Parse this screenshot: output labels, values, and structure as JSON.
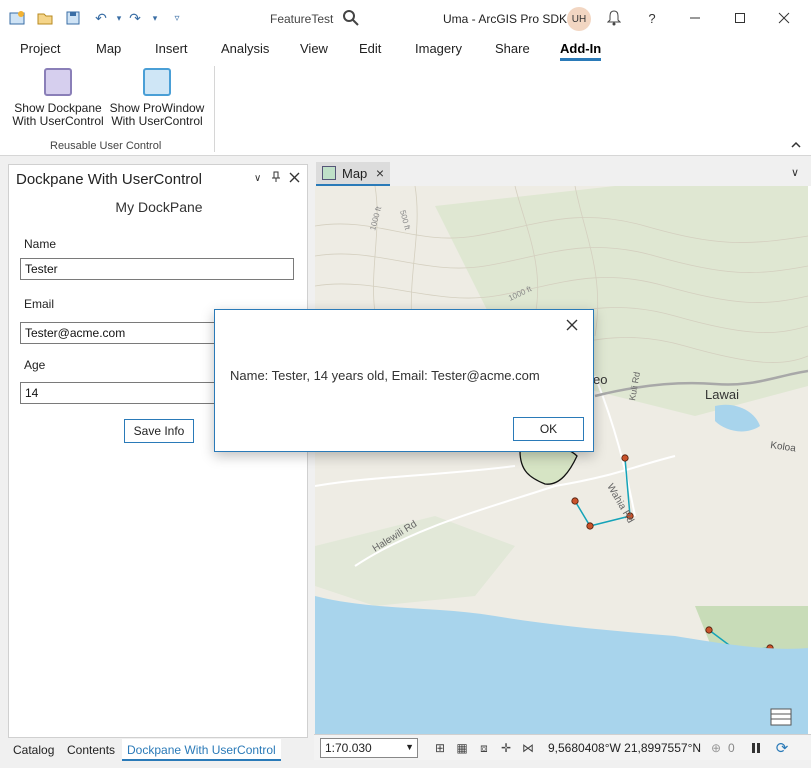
{
  "titlebar": {
    "document": "FeatureTest",
    "title": "Uma - ArcGIS Pro SDK",
    "avatar_initials": "UH",
    "help_label": "?"
  },
  "ribbon_tabs": [
    {
      "label": "Project"
    },
    {
      "label": "Map"
    },
    {
      "label": "Insert"
    },
    {
      "label": "Analysis"
    },
    {
      "label": "View"
    },
    {
      "label": "Edit"
    },
    {
      "label": "Imagery"
    },
    {
      "label": "Share"
    },
    {
      "label": "Add-In",
      "active": true
    }
  ],
  "ribbon": {
    "buttons": [
      {
        "line1": "Show Dockpane",
        "line2": "With UserControl",
        "icon": "dockpane-icon",
        "color": "#8a7fb8"
      },
      {
        "line1": "Show ProWindow",
        "line2": "With UserControl",
        "icon": "prowindow-icon",
        "color": "#4a9fd6"
      }
    ],
    "group_label": "Reusable User Control"
  },
  "dockpane": {
    "title": "Dockpane With UserControl",
    "heading": "My DockPane",
    "name_label": "Name",
    "name_value": "Tester",
    "email_label": "Email",
    "email_value": "Tester@acme.com",
    "age_label": "Age",
    "age_value": "14",
    "save_label": "Save Info"
  },
  "bottom_tabs": [
    {
      "label": "Catalog"
    },
    {
      "label": "Contents"
    },
    {
      "label": "Dockpane With UserControl",
      "active": true
    }
  ],
  "map": {
    "tab_label": "Map",
    "places": [
      "Lawai",
      "Koloa",
      "Halewili Rd",
      "Wahia Rd",
      "Kuli Rd",
      "1000 ft",
      "500 ft",
      "1000 ft",
      "eo"
    ]
  },
  "statusbar": {
    "scale": "1:70.030",
    "coords": "9,5680408°W 21,8997557°N",
    "selected_count": "0"
  },
  "message": {
    "text": "Name: Tester, 14 years old, Email: Tester@acme.com",
    "ok_label": "OK"
  },
  "colors": {
    "accent": "#2a7ab8",
    "water": "#a8d4ec",
    "land": "#eeece4",
    "route": "#14a3b8"
  }
}
